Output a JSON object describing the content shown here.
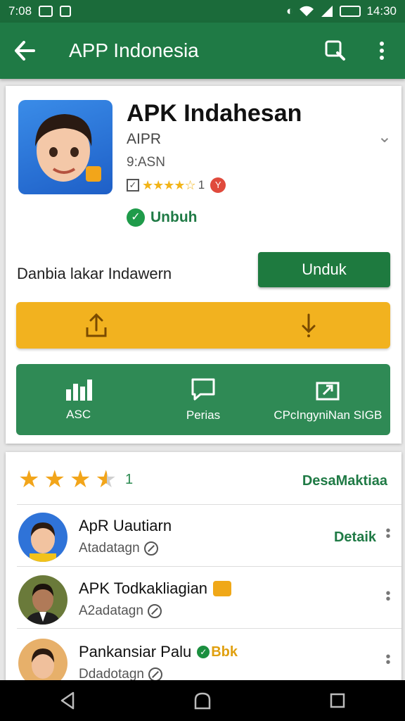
{
  "status": {
    "left_text": "7:08",
    "time": "14:30"
  },
  "appbar": {
    "title": "APP Indonesia"
  },
  "app": {
    "name": "APK Indahesan",
    "developer": "AIPR",
    "category": "9:ASN",
    "rating_count": "1",
    "installed_label": "Unbuh",
    "description": "Danbia lakar Indawern",
    "download_label": "Unduk"
  },
  "actions": [
    {
      "label": "ASC",
      "icon": "bar-chart-icon"
    },
    {
      "label": "Perias",
      "icon": "comment-icon"
    },
    {
      "label": "CPcIngyniNan SIGB",
      "icon": "share-icon"
    }
  ],
  "reviews": {
    "rating_value": 3.5,
    "count": "1",
    "see_all": "DesaMaktiaa",
    "items": [
      {
        "name": "ApR Uautiarn",
        "sub": "Atadatagn",
        "detail": "Detaik"
      },
      {
        "name": "APK Todkakliagian",
        "sub": "A2adatagn",
        "detail": ""
      },
      {
        "name": "Pankansiar Palu",
        "sub": "Ddadotagn",
        "detail": "",
        "badge_text": "Bbk"
      }
    ]
  },
  "colors": {
    "primary": "#1f7a45",
    "accent": "#f2b21f",
    "panel": "#2f8a55"
  }
}
